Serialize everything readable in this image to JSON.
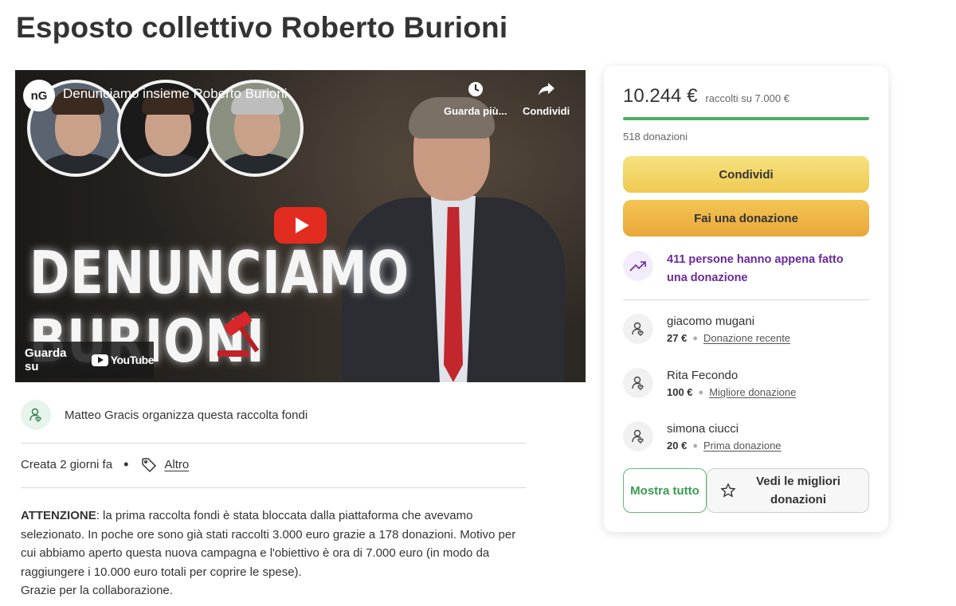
{
  "page": {
    "title": "Esposto collettivo Roberto Burioni"
  },
  "video": {
    "channel_logo": "nG",
    "title": "Denunciamo insieme Roberto Burioni",
    "watch_later_label": "Guarda più...",
    "share_label": "Condividi",
    "overlay_text_line1": "DENUNCIAMO",
    "overlay_text_line2": "BURIONI",
    "watch_on_label": "Guarda su",
    "youtube_label": "YouTube",
    "icons": [
      "clock-icon",
      "share-arrow-icon",
      "play-icon",
      "gavel-icon",
      "youtube-logo-icon"
    ]
  },
  "organizer": {
    "text": "Matteo Gracis organizza questa raccolta fondi",
    "icon": "heart-hand-icon"
  },
  "meta": {
    "created": "Creata 2 giorni fa",
    "bullet": "•",
    "category": "Altro",
    "icon": "tag-icon"
  },
  "description": {
    "bold_lead": "ATTENZIONE",
    "body": ": la prima raccolta fondi è stata bloccata dalla piattaforma che avevamo selezionato. In poche ore sono già stati raccolti 3.000 euro grazie a 178 donazioni. Motivo per cui abbiamo aperto questa nuova campagna e l'obiettivo è ora di 7.000 euro (in modo da raggiungere i 10.000 euro totali per coprire le spese).",
    "closing": "Grazie per la collaborazione."
  },
  "card": {
    "amount_raised": "10.244 €",
    "goal_text": "raccolti su 7.000 €",
    "progress_fraction": 1.0,
    "donations_count": "518 donazioni",
    "share_button": "Condividi",
    "donate_button": "Fai una donazione",
    "trend_text": "411 persone hanno appena fatto una donazione",
    "trend_icon": "trending-up-icon",
    "donors": [
      {
        "name": "giacomo mugani",
        "amount": "27 €",
        "label": "Donazione recente"
      },
      {
        "name": "Rita Fecondo",
        "amount": "100 €",
        "label": "Migliore donazione"
      },
      {
        "name": "simona ciucci",
        "amount": "20 €",
        "label": "Prima donazione"
      }
    ],
    "show_all_button": "Mostra tutto",
    "best_donations_button": "Vedi le migliori donazioni",
    "colors": {
      "progress": "#4caf63",
      "share_button": "#efc952",
      "donate_button": "#e9a73a",
      "trend_text": "#6a2a9a",
      "show_all_border": "#5fb873"
    }
  }
}
